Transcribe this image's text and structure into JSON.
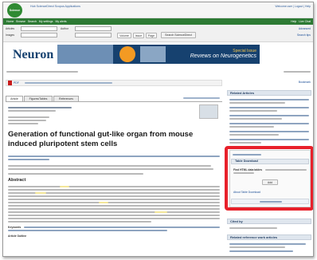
{
  "app": {
    "name": "Science Direct"
  },
  "topnav": {
    "items": [
      "Home",
      "Browse",
      "Search",
      "My settings",
      "Alerts"
    ],
    "right_links": [
      "Help"
    ]
  },
  "banner": {
    "title": "Neuron"
  },
  "article": {
    "title": "Generation of functional gut-like organ from mouse induced pluripotent stem cells",
    "tabs": [
      "Article",
      "Figures/Tables",
      "References"
    ],
    "abstract_heading": "Abstract",
    "keywords_label": "Keywords",
    "outline_label": "Article Outline"
  },
  "toolbar": {
    "pdf_label": "PDF"
  },
  "sidebar": {
    "related_articles": "Related Articles",
    "table_download": "Table Download",
    "find_prefix": "Find HTML data tables",
    "add_button": "Add",
    "about_link": "About Table Download",
    "cited_by": "Cited by",
    "related_ref": "Related reference work articles"
  },
  "colors": {
    "highlight_box": "#e8202a",
    "brand_green": "#2f8a33",
    "banner_blue": "#16416f"
  }
}
